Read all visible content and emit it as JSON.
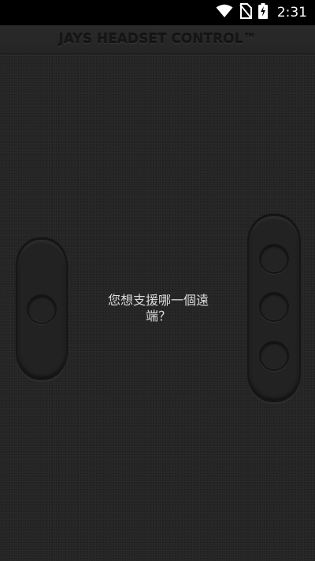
{
  "status_bar": {
    "time": "2:31",
    "icons": [
      "wifi-icon",
      "no-sim-icon",
      "battery-charging-icon"
    ]
  },
  "app": {
    "title": "JAYS HEADSET CONTROL™",
    "prompt": "您想支援哪一個遠端？"
  },
  "remotes": {
    "left": {
      "button_count": 1
    },
    "right": {
      "button_count": 3
    }
  },
  "colors": {
    "background": "#242424",
    "status_bar": "#000000",
    "title_text": "#161616",
    "prompt_text": "#dcdcdc"
  }
}
